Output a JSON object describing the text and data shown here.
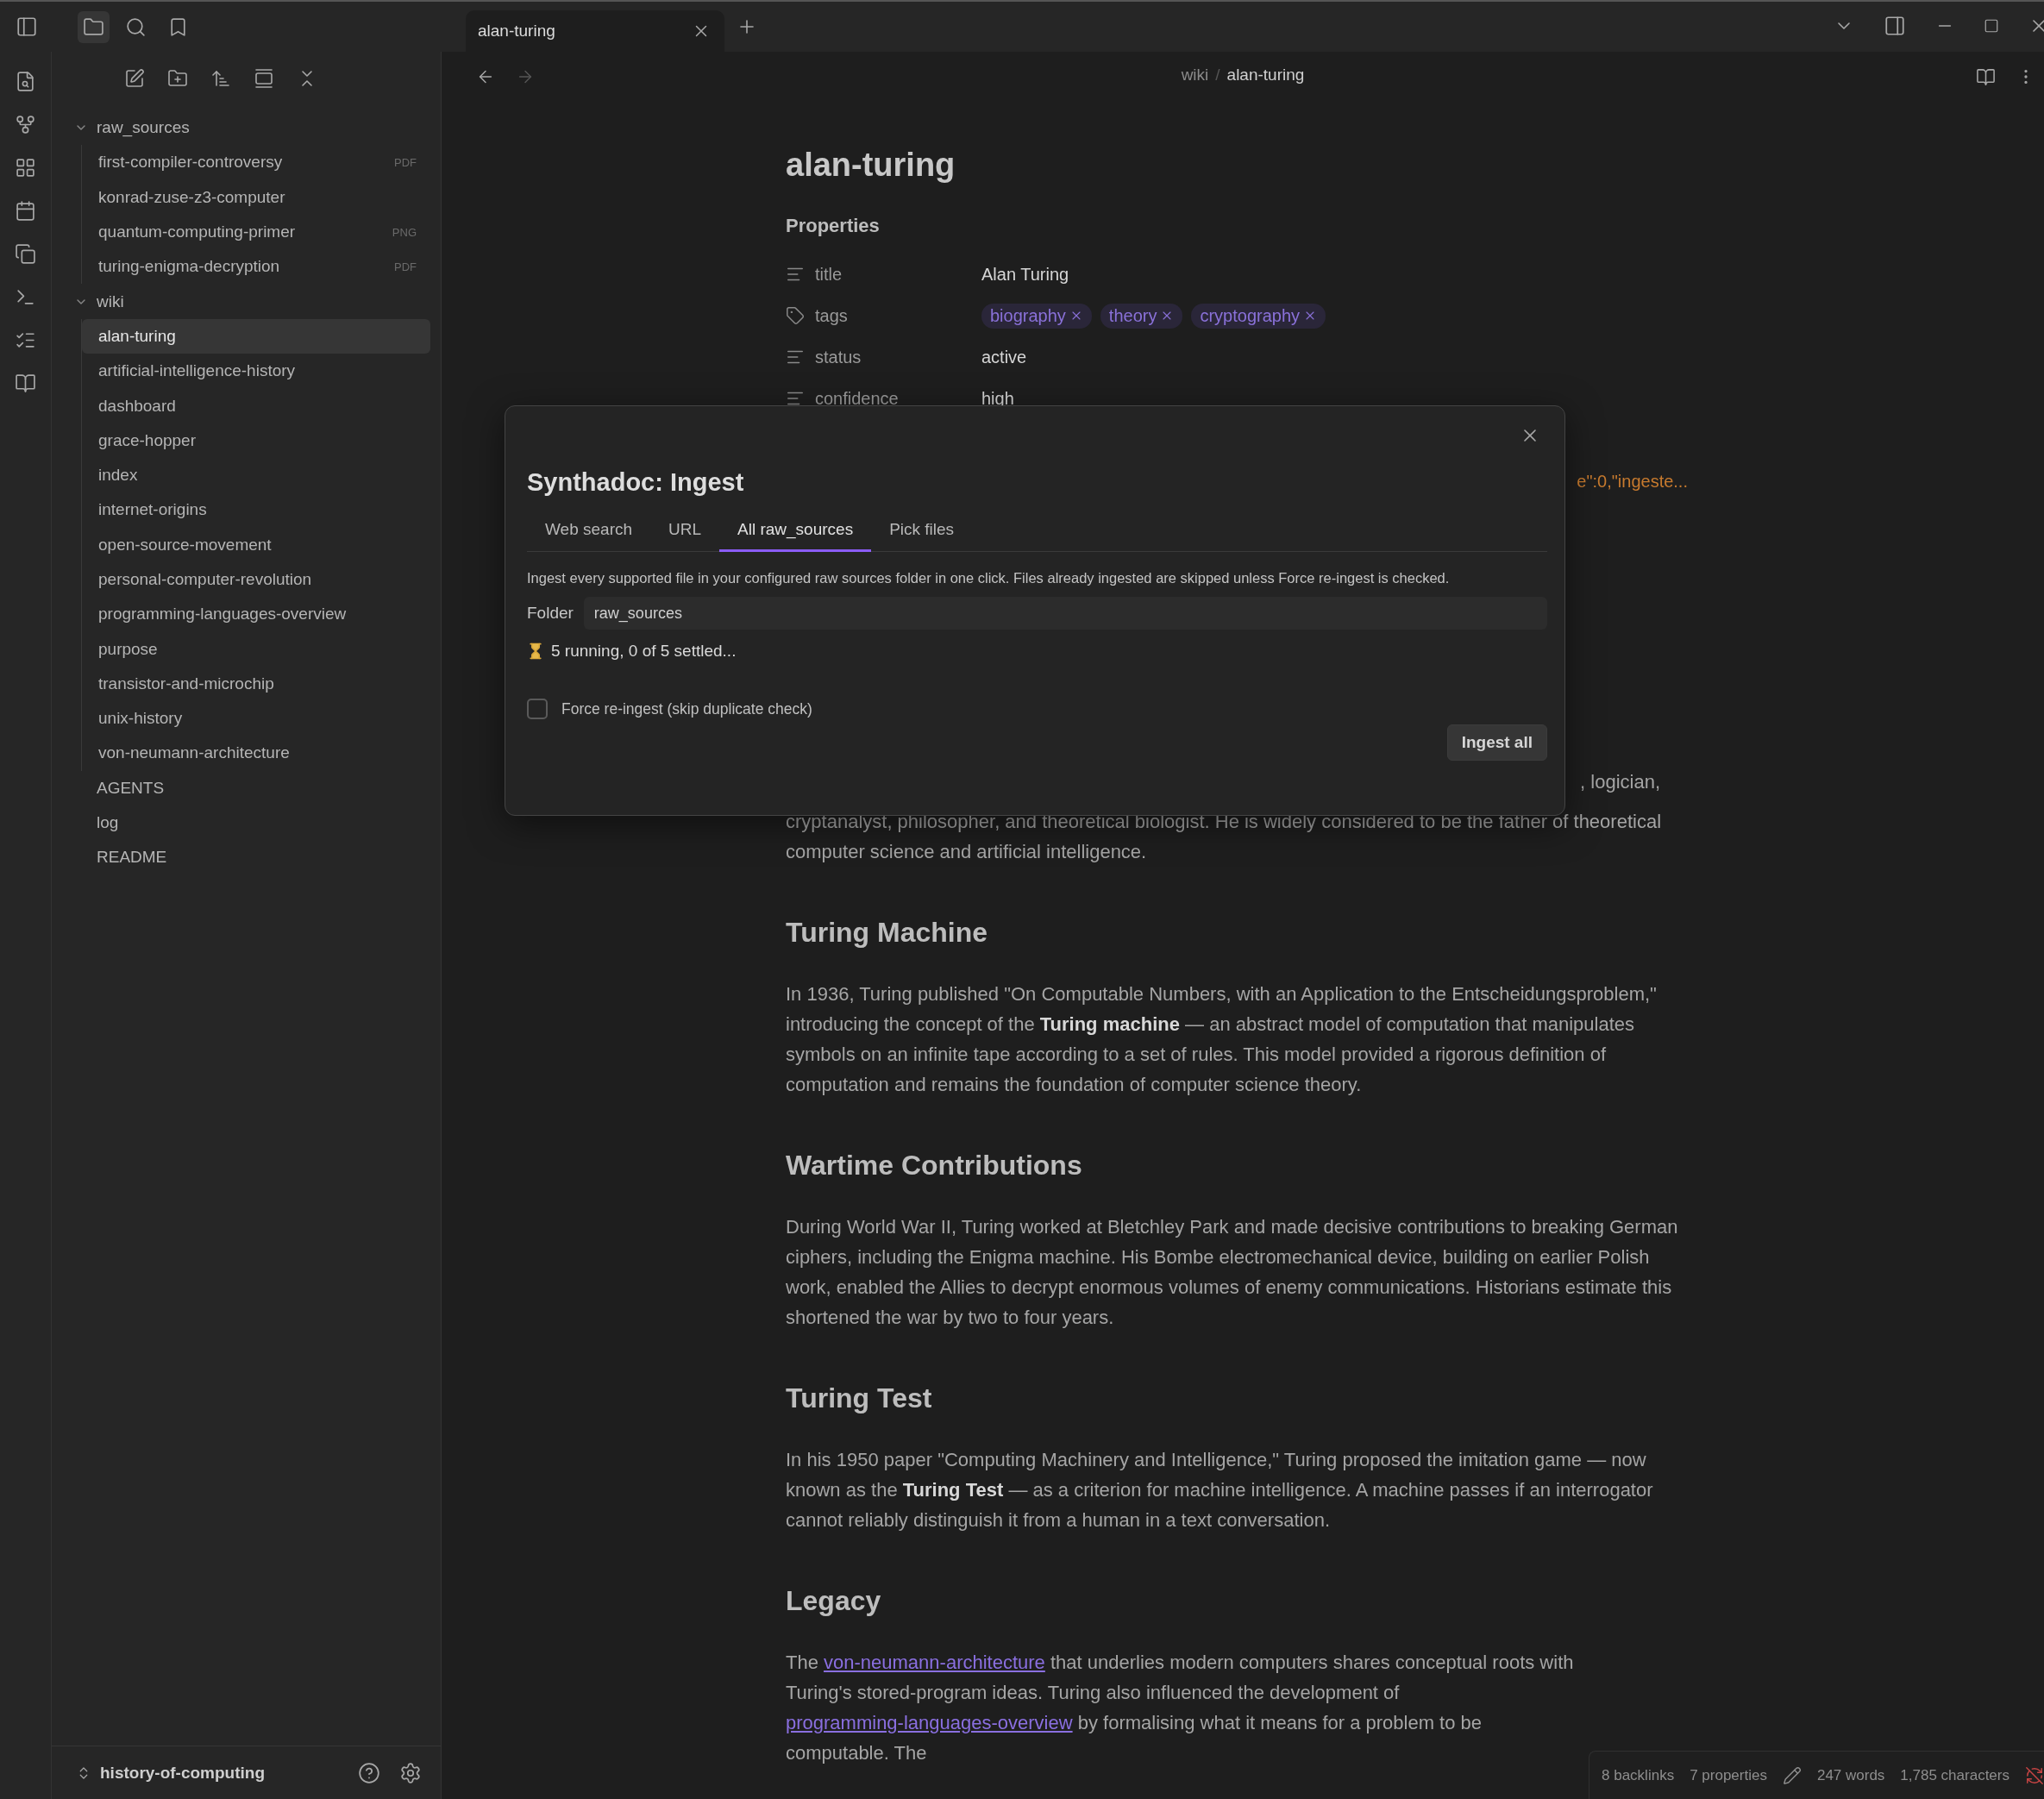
{
  "sidebar_tabs": [
    {
      "kind": "files",
      "selected": true
    },
    {
      "kind": "search",
      "selected": false
    },
    {
      "kind": "bookmarks",
      "selected": false
    }
  ],
  "tabs": [
    {
      "label": "alan-turing",
      "selected": true
    }
  ],
  "file_tree": [
    {
      "label": "raw_sources",
      "kind": "folder",
      "expanded": true,
      "selected": false,
      "children": [
        {
          "label": "first-compiler-controversy",
          "kind": "file",
          "badge": "PDF",
          "selected": false
        },
        {
          "label": "konrad-zuse-z3-computer",
          "kind": "file",
          "selected": false
        },
        {
          "label": "quantum-computing-primer",
          "kind": "file",
          "badge": "PNG",
          "selected": false
        },
        {
          "label": "turing-enigma-decryption",
          "kind": "file",
          "badge": "PDF",
          "selected": false
        }
      ]
    },
    {
      "label": "wiki",
      "kind": "folder",
      "expanded": true,
      "selected": false,
      "children": [
        {
          "label": "alan-turing",
          "kind": "file",
          "selected": true
        },
        {
          "label": "artificial-intelligence-history",
          "kind": "file",
          "selected": false
        },
        {
          "label": "dashboard",
          "kind": "file",
          "selected": false
        },
        {
          "label": "grace-hopper",
          "kind": "file",
          "selected": false
        },
        {
          "label": "index",
          "kind": "file",
          "selected": false
        },
        {
          "label": "internet-origins",
          "kind": "file",
          "selected": false
        },
        {
          "label": "open-source-movement",
          "kind": "file",
          "selected": false
        },
        {
          "label": "personal-computer-revolution",
          "kind": "file",
          "selected": false
        },
        {
          "label": "programming-languages-overview",
          "kind": "file",
          "selected": false
        },
        {
          "label": "purpose",
          "kind": "file",
          "selected": false
        },
        {
          "label": "transistor-and-microchip",
          "kind": "file",
          "selected": false
        },
        {
          "label": "unix-history",
          "kind": "file",
          "selected": false
        },
        {
          "label": "von-neumann-architecture",
          "kind": "file",
          "selected": false
        }
      ]
    },
    {
      "label": "AGENTS",
      "kind": "file",
      "selected": false
    },
    {
      "label": "log",
      "kind": "file",
      "selected": false
    },
    {
      "label": "README",
      "kind": "file",
      "selected": false
    }
  ],
  "vault": {
    "name": "history-of-computing"
  },
  "breadcrumb": [
    "wiki",
    "alan-turing"
  ],
  "breadcrumb_separator": "/",
  "note": {
    "title": "alan-turing",
    "properties_heading": "Properties",
    "properties": [
      {
        "kind": "text",
        "name": "title",
        "value": "Alan Turing"
      },
      {
        "kind": "tags",
        "name": "tags",
        "tags": [
          "biography",
          "theory",
          "cryptography"
        ]
      },
      {
        "kind": "text",
        "name": "status",
        "value": "active"
      },
      {
        "kind": "text",
        "name": "confidence",
        "value": "high"
      }
    ],
    "property_fragment": "e\":0,\"ingeste...",
    "blocks": [
      {
        "kind": "fragment",
        "text": ", logician,"
      },
      {
        "kind": "paragraph",
        "segments": [
          {
            "kind": "text",
            "text": "cryptanalyst, philosopher, and theoretical biologist. He is widely considered to be the father of theoretical computer science and artificial intelligence."
          }
        ]
      },
      {
        "kind": "heading",
        "text": "Turing Machine"
      },
      {
        "kind": "paragraph",
        "segments": [
          {
            "kind": "text",
            "text": "In 1936, Turing published \"On Computable Numbers, with an Application to the Entscheidungsproblem,\" introducing the concept of the **Turing machine** — an abstract model of computation that manipulates symbols on an infinite tape according to a set of rules. This model provided a rigorous definition of computation and remains the foundation of computer science theory."
          }
        ]
      },
      {
        "kind": "heading",
        "text": "Wartime Contributions"
      },
      {
        "kind": "paragraph",
        "segments": [
          {
            "kind": "text",
            "text": "During World War II, Turing worked at Bletchley Park and made decisive contributions to breaking German ciphers, including the Enigma machine. His Bombe electromechanical device, building on earlier Polish work, enabled the Allies to decrypt enormous volumes of enemy communications. Historians estimate this shortened the war by two to four years."
          }
        ]
      },
      {
        "kind": "heading",
        "text": "Turing Test"
      },
      {
        "kind": "paragraph",
        "segments": [
          {
            "kind": "text",
            "text": "In his 1950 paper \"Computing Machinery and Intelligence,\" Turing proposed the imitation game — now known as the **Turing Test** — as a criterion for machine intelligence. A machine passes if an interrogator cannot reliably distinguish it from a human in a text conversation."
          }
        ]
      },
      {
        "kind": "heading",
        "text": "Legacy"
      },
      {
        "kind": "paragraph",
        "segments": [
          {
            "kind": "text",
            "text": "The "
          },
          {
            "kind": "link",
            "text": "von-neumann-architecture"
          },
          {
            "kind": "text",
            "text": " that underlies modern computers shares conceptual roots with Turing's stored-program ideas. Turing also influenced the development of "
          },
          {
            "kind": "link",
            "text": "programming-languages-overview"
          },
          {
            "kind": "text",
            "text": " by formalising what it means for a problem to be computable. The"
          }
        ]
      }
    ]
  },
  "status_bar": {
    "backlinks": "8 backlinks",
    "properties": "7 properties",
    "words": "247 words",
    "characters": "1,785 characters"
  },
  "modal": {
    "title": "Synthadoc: Ingest",
    "tabs": [
      {
        "label": "Web search",
        "selected": false
      },
      {
        "label": "URL",
        "selected": false
      },
      {
        "label": "All raw_sources",
        "selected": true
      },
      {
        "label": "Pick files",
        "selected": false
      }
    ],
    "description": "Ingest every supported file in your configured raw sources folder in one click. Files already ingested are skipped unless Force re-ingest is checked.",
    "folder_label": "Folder",
    "folder_value": "raw_sources",
    "progress": "5 running, 0 of 5 settled...",
    "force_option": {
      "label": "Force re-ingest (skip duplicate check)",
      "checked": false
    },
    "button": "Ingest all"
  }
}
